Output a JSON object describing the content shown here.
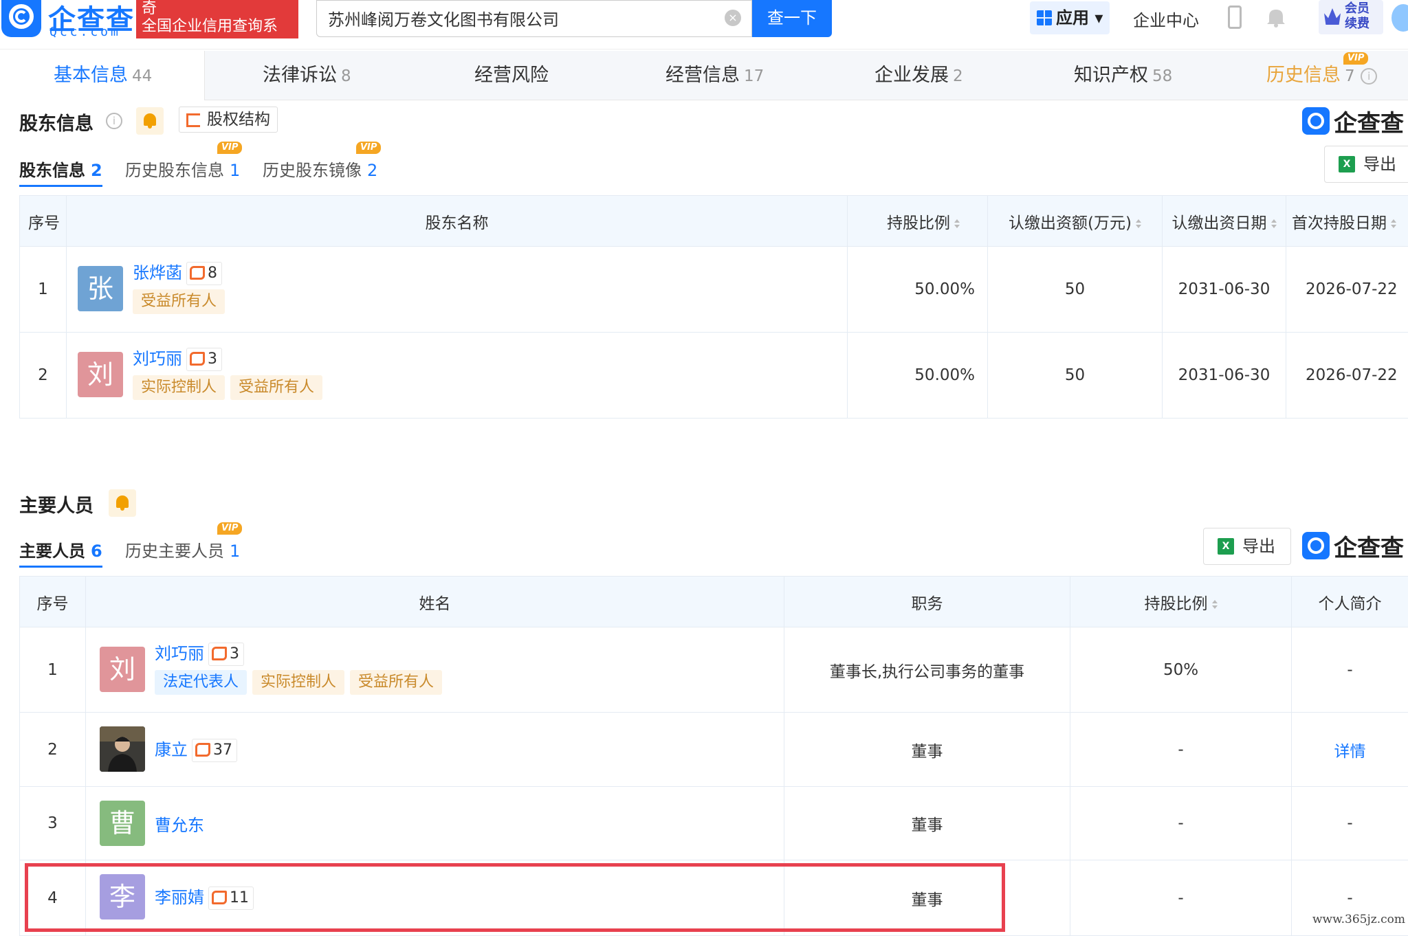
{
  "header": {
    "logo_text": "企查查",
    "logo_sub": "Qcc.com",
    "slogan_line1": "奇",
    "slogan_line2": "全国企业信用查询系",
    "search_value": "苏州峰阅万卷文化图书有限公司",
    "search_button": "查一下",
    "app_label": "应用",
    "enterprise_center": "企业中心",
    "vip_line1": "会员",
    "vip_line2": "续费"
  },
  "tabs": [
    {
      "label": "基本信息",
      "count": "44"
    },
    {
      "label": "法律诉讼",
      "count": "8"
    },
    {
      "label": "经营风险",
      "count": ""
    },
    {
      "label": "经营信息",
      "count": "17"
    },
    {
      "label": "企业发展",
      "count": "2"
    },
    {
      "label": "知识产权",
      "count": "58"
    },
    {
      "label": "历史信息",
      "count": "7",
      "badge": "VIP"
    }
  ],
  "shareholders": {
    "title": "股东信息",
    "equity_button": "股权结构",
    "brand": "企查查",
    "export": "导出",
    "subtabs": [
      {
        "label": "股东信息",
        "count": "2"
      },
      {
        "label": "历史股东信息",
        "count": "1",
        "badge": "VIP"
      },
      {
        "label": "历史股东镜像",
        "count": "2",
        "badge": "VIP"
      }
    ],
    "columns": [
      "序号",
      "股东名称",
      "持股比例",
      "认缴出资额(万元)",
      "认缴出资日期",
      "首次持股日期"
    ],
    "rows": [
      {
        "no": "1",
        "avatar": "张",
        "avatar_color": "#6fa3d4",
        "name": "张烨菡",
        "rel_count": "8",
        "tags": [
          "受益所有人"
        ],
        "ratio": "50.00%",
        "amount": "50",
        "date": "2031-06-30",
        "first_date": "2026-07-22"
      },
      {
        "no": "2",
        "avatar": "刘",
        "avatar_color": "#e0959a",
        "name": "刘巧丽",
        "rel_count": "3",
        "tags": [
          "实际控制人",
          "受益所有人"
        ],
        "ratio": "50.00%",
        "amount": "50",
        "date": "2031-06-30",
        "first_date": "2026-07-22"
      }
    ]
  },
  "personnel": {
    "title": "主要人员",
    "export": "导出",
    "brand": "企查查",
    "subtabs": [
      {
        "label": "主要人员",
        "count": "6"
      },
      {
        "label": "历史主要人员",
        "count": "1",
        "badge": "VIP"
      }
    ],
    "columns": [
      "序号",
      "姓名",
      "职务",
      "持股比例",
      "个人简介"
    ],
    "rows": [
      {
        "no": "1",
        "avatar": "刘",
        "avatar_color": "#e0959a",
        "name": "刘巧丽",
        "rel_count": "3",
        "tags": [
          "法定代表人",
          "实际控制人",
          "受益所有人"
        ],
        "position": "董事长,执行公司事务的董事",
        "ratio": "50%",
        "intro": "-"
      },
      {
        "no": "2",
        "avatar": "",
        "avatar_color": "#3a3a3a",
        "name": "康立",
        "rel_count": "37",
        "tags": [],
        "position": "董事",
        "ratio": "-",
        "intro": "详情"
      },
      {
        "no": "3",
        "avatar": "曹",
        "avatar_color": "#86bb7e",
        "name": "曹允东",
        "rel_count": "",
        "tags": [],
        "position": "董事",
        "ratio": "-",
        "intro": "-"
      },
      {
        "no": "4",
        "avatar": "李",
        "avatar_color": "#a69ee0",
        "name": "李丽婧",
        "rel_count": "11",
        "tags": [],
        "position": "董事",
        "ratio": "-",
        "intro": "-"
      }
    ]
  },
  "watermark": "www.365jz.com"
}
